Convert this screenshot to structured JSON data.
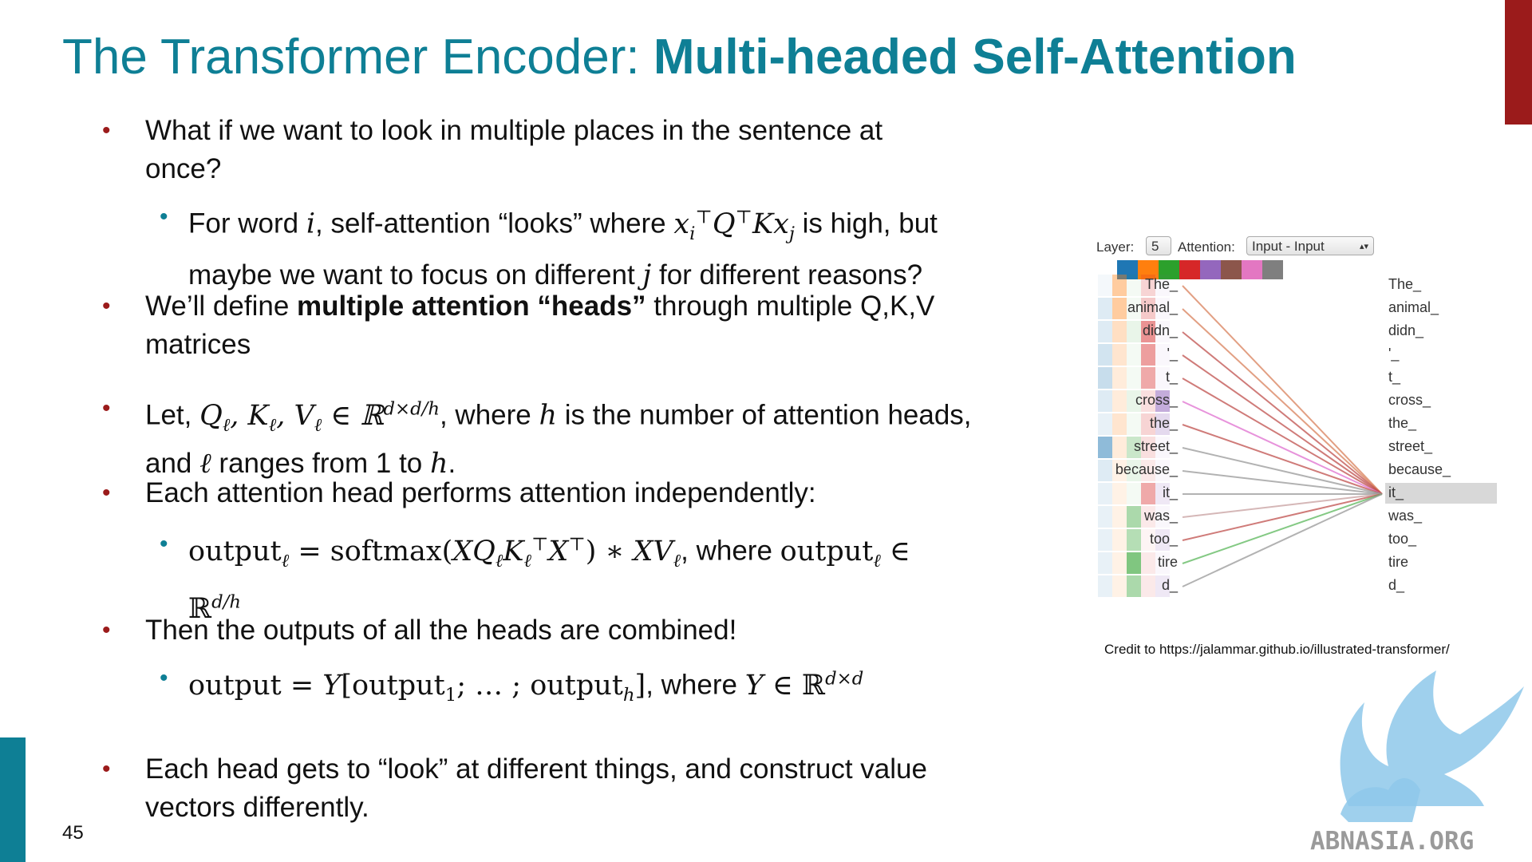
{
  "title": {
    "prefix": "The Transformer Encoder: ",
    "bold": "Multi-headed Self-Attention"
  },
  "page_number": "45",
  "bullets": {
    "b1_line1": "What if we want to look in multiple places in the sentence at",
    "b1_line2": "once?",
    "b1a_pre": "For word ",
    "b1a_mid": ", self-attention “looks” where ",
    "b1a_post": " is high, but",
    "b1a_line2_pre": "maybe we want to focus on different ",
    "b1a_line2_post": " for different reasons?",
    "b2_pre": "We’ll define ",
    "b2_bold": "multiple attention “heads”",
    "b2_post": " through multiple Q,K,V",
    "b2_line2": "matrices",
    "b3_pre": "Let, ",
    "b3_mid": ", where ",
    "b3_post": " is the number of attention heads,",
    "b3_line2_pre": "and ",
    "b3_line2_mid": " ranges from 1 to ",
    "b3_line2_post": ".",
    "b4": "Each attention head performs attention independently:",
    "b4a_where": ", where ",
    "b5": "Then the outputs of all the heads are combined!",
    "b5a_where": ", where ",
    "b6_line1": "Each head gets to “look” at different things, and construct value",
    "b6_line2": "vectors differently."
  },
  "viz": {
    "layer_label": "Layer:",
    "layer_value": "5",
    "attention_label": "Attention:",
    "attention_value": "Input - Input",
    "head_colors": [
      "#1f77b4",
      "#ff7f0e",
      "#2ca02c",
      "#d62728",
      "#9467bd",
      "#8c564b",
      "#e377c2",
      "#7f7f7f"
    ],
    "left_words": [
      "The_",
      "animal_",
      "didn_",
      "'_",
      "t_",
      "cross_",
      "the_",
      "street_",
      "because_",
      "it_",
      "was_",
      "too_",
      "tire",
      "d_"
    ],
    "right_words": [
      "The_",
      "animal_",
      "didn_",
      "'_",
      "t_",
      "cross_",
      "the_",
      "street_",
      "because_",
      "it_",
      "was_",
      "too_",
      "tire",
      "d_"
    ],
    "selected_word": "it_"
  },
  "credit": "Credit to https://jalammar.github.io/illustrated-transformer/",
  "watermark": "ABNASIA.ORG"
}
